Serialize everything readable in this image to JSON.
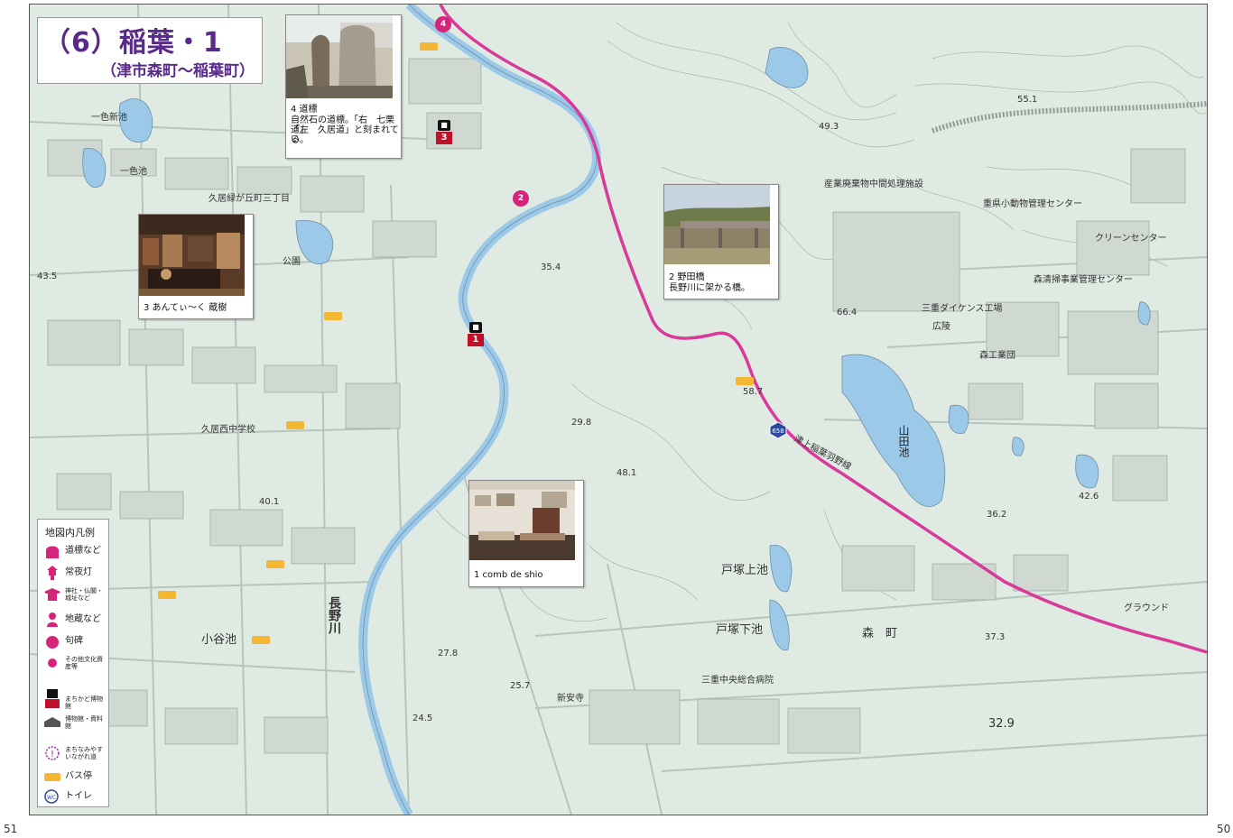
{
  "title": {
    "main": "（6）稲葉・1",
    "sub": "（津市森町〜稲葉町）"
  },
  "photo_cards": [
    {
      "id": "4",
      "caption_lines": [
        "4 道標",
        "自然石の道標。「右　七栗道」",
        "「左　久居道」と刻まれてい",
        "る。"
      ]
    },
    {
      "id": "3",
      "caption_lines": [
        "3 あんてぃ〜く 蔵樹"
      ]
    },
    {
      "id": "2",
      "caption_lines": [
        "2 野田橋",
        "長野川に架かる橋。"
      ]
    },
    {
      "id": "1",
      "caption_lines": [
        "1 comb de shio"
      ]
    }
  ],
  "markers": {
    "museum_1": "1",
    "museum_3": "3",
    "poi_2": "2",
    "poi_4": "4",
    "route_number": "658"
  },
  "map_labels": {
    "river": "長野川",
    "pond_yamada": "山田池",
    "pond_tozuka_upper": "戸塚上池",
    "pond_tozuka_lower": "戸塚下池",
    "pond_oya": "小谷池",
    "pond_isshiki": "一色池",
    "pond_isshiki_new": "一色新池",
    "hisai_midorigaoka": "久居緑が丘町三丁目",
    "hisai_nishi_jhs": "久居西中学校",
    "mori": "森　町",
    "road_name": "津上稲葉羽野線",
    "industrial": "森工業団",
    "ground": "グラウンド",
    "park": "公園",
    "daikin": "三重ダイケンス工場",
    "mie_chuo": "三重中央総合病院",
    "shinsen_yashiki": "新安寺",
    "kosha": "広陵",
    "clean": "クリーンセンター",
    "hq": "森清掃事業管理センター",
    "sangyo": "産業廃棄物中間処理施設",
    "animals": "重県小動物管理センター",
    "elev_1": "55.1",
    "elev_2": "43.5",
    "elev_3": "29.8",
    "elev_4": "48.1",
    "elev_5": "66.4",
    "elev_6": "58.7",
    "elev_7": "42.6",
    "elev_8": "37.3",
    "elev_9": "32.9",
    "elev_10": "24.5",
    "elev_11": "27.8",
    "elev_12": "25.7",
    "elev_13": "40.1",
    "elev_14": "35.4",
    "elev_15": "49.3",
    "elev_16": "36.2"
  },
  "legend": {
    "title": "地図内凡例",
    "items": [
      {
        "label": "道標など",
        "icon": "milestone-icon",
        "color": "#d6247a"
      },
      {
        "label": "常夜灯",
        "icon": "lantern-icon",
        "color": "#d6247a"
      },
      {
        "label": "神社・仏閣・城址など",
        "icon": "shrine-icon",
        "color": "#d6247a"
      },
      {
        "label": "地蔵など",
        "icon": "jizo-icon",
        "color": "#d6247a"
      },
      {
        "label": "句碑",
        "icon": "haiku-stone-icon",
        "color": "#d6247a"
      },
      {
        "label": "その他文化資産等",
        "icon": "dot-icon",
        "color": "#d6247a"
      },
      {
        "label": "まちかど博物館",
        "icon": "machikado-museum-icon",
        "color": "#c0102a"
      },
      {
        "label": "博物館・資料館",
        "icon": "museum-icon",
        "color": "#555555"
      },
      {
        "label": "まちなみやすいながれ道",
        "icon": "caution-icon",
        "color": "#9b2b9b"
      },
      {
        "label": "バス停",
        "icon": "bus-stop-icon",
        "color": "#f5b731"
      },
      {
        "label": "トイレ",
        "icon": "toilet-icon",
        "color": "#2c4a9b"
      }
    ]
  },
  "page_numbers": {
    "left": "51",
    "right": "50"
  },
  "colors": {
    "map_bg": "#dfeae2",
    "water": "#9cc9e8",
    "route": "#d93a9a",
    "title": "#5a2a8a",
    "bus": "#f5b731"
  }
}
